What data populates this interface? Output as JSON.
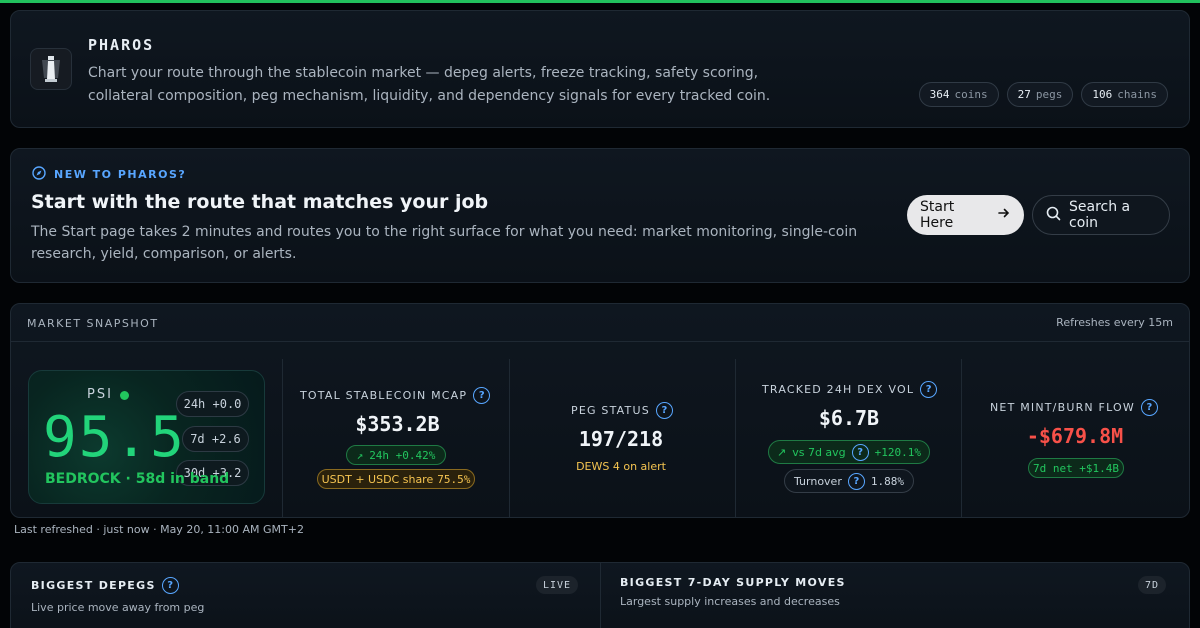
{
  "header": {
    "brand": "PHAROS",
    "tagline": "Chart your route through the stablecoin market — depeg alerts, freeze tracking, safety scoring, collateral composition, peg mechanism, liquidity, and dependency signals for every tracked coin.",
    "stats": [
      {
        "num": "364",
        "unit": "coins"
      },
      {
        "num": "27",
        "unit": "pegs"
      },
      {
        "num": "106",
        "unit": "chains"
      }
    ]
  },
  "intro": {
    "tag": "NEW TO PHAROS?",
    "title": "Start with the route that matches your job",
    "text": "The Start page takes 2 minutes and routes you to the right surface for what you need: market monitoring, single-coin research, yield, comparison, or alerts.",
    "start_label": "Start Here",
    "search_label": "Search a coin"
  },
  "snapshot": {
    "title": "MARKET SNAPSHOT",
    "refresh": "Refreshes every 15m",
    "psi": {
      "label": "PSI",
      "value": "95.5",
      "band": "BEDROCK · 58d in band",
      "changes": [
        "24h +0.0",
        "7d +2.6",
        "30d +3.2"
      ]
    },
    "mcap": {
      "title": "TOTAL STABLECOIN MCAP",
      "value": "$353.2B",
      "change": "24h +0.42%",
      "share_label": "USDT + USDC share",
      "share_value": "75.5%"
    },
    "peg": {
      "title": "PEG STATUS",
      "value": "197/218",
      "sub": "DEWS 4 on alert"
    },
    "dex": {
      "title": "TRACKED 24H DEX VOL",
      "value": "$6.7B",
      "avg_label": "vs 7d avg",
      "avg_value": "+120.1%",
      "turnover_label": "Turnover",
      "turnover_value": "1.88%"
    },
    "flow": {
      "title": "NET MINT/BURN FLOW",
      "value": "-$679.8M",
      "sub": "7d net +$1.4B"
    },
    "colors": {
      "positive": "#22c55e",
      "negative": "#f85149",
      "warning": "#f5c451",
      "accent": "#58a6ff"
    }
  },
  "last_refreshed": "Last refreshed · just now · May 20, 11:00 AM GMT+2",
  "bottom": {
    "left": {
      "title": "BIGGEST DEPEGS",
      "sub": "Live price move away from peg",
      "badge": "LIVE"
    },
    "right": {
      "title": "BIGGEST 7-DAY SUPPLY MOVES",
      "sub": "Largest supply increases and decreases",
      "badge": "7D"
    }
  },
  "icons": [
    "lighthouse-logo-icon",
    "compass-icon",
    "arrow-right-icon",
    "search-icon",
    "question-icon",
    "trend-up-icon"
  ]
}
